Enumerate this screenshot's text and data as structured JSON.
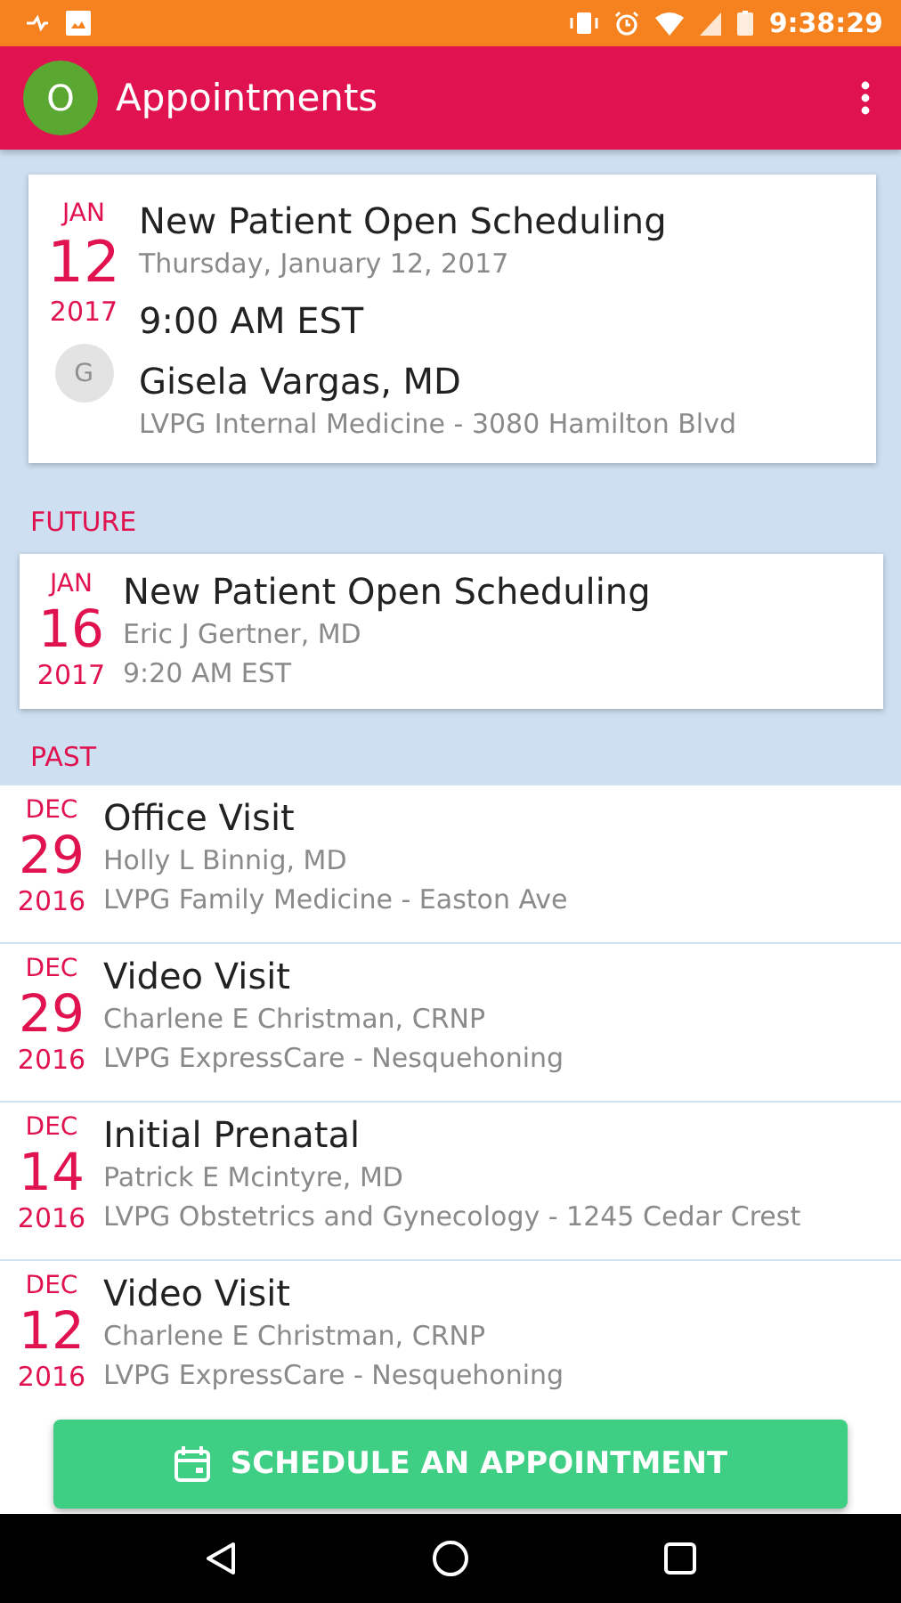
{
  "status_bar": {
    "time": "9:38:29"
  },
  "app_bar": {
    "avatar_letter": "O",
    "title": "Appointments"
  },
  "upcoming": {
    "month": "JAN",
    "day": "12",
    "year": "2017",
    "title": "New Patient Open Scheduling",
    "date_line": "Thursday, January 12, 2017",
    "time": "9:00 AM EST",
    "provider_initial": "G",
    "provider": "Gisela Vargas, MD",
    "location": "LVPG Internal Medicine - 3080 Hamilton Blvd"
  },
  "future": {
    "heading": "FUTURE",
    "items": [
      {
        "month": "JAN",
        "day": "16",
        "year": "2017",
        "title": "New Patient Open Scheduling",
        "provider": "Eric J Gertner, MD",
        "time": "9:20 AM EST"
      }
    ]
  },
  "past": {
    "heading": "PAST",
    "items": [
      {
        "month": "DEC",
        "day": "29",
        "year": "2016",
        "title": "Office Visit",
        "provider": "Holly L Binnig, MD",
        "location": "LVPG Family Medicine - Easton Ave"
      },
      {
        "month": "DEC",
        "day": "29",
        "year": "2016",
        "title": "Video Visit",
        "provider": "Charlene E Christman, CRNP",
        "location": "LVPG ExpressCare - Nesquehoning"
      },
      {
        "month": "DEC",
        "day": "14",
        "year": "2016",
        "title": "Initial Prenatal",
        "provider": "Patrick E Mcintyre, MD",
        "location": "LVPG Obstetrics and Gynecology - 1245 Cedar Crest"
      },
      {
        "month": "DEC",
        "day": "12",
        "year": "2016",
        "title": "Video Visit",
        "provider": "Charlene E Christman, CRNP",
        "location": "LVPG ExpressCare - Nesquehoning"
      }
    ]
  },
  "action_button": {
    "label": "SCHEDULE AN APPOINTMENT"
  }
}
